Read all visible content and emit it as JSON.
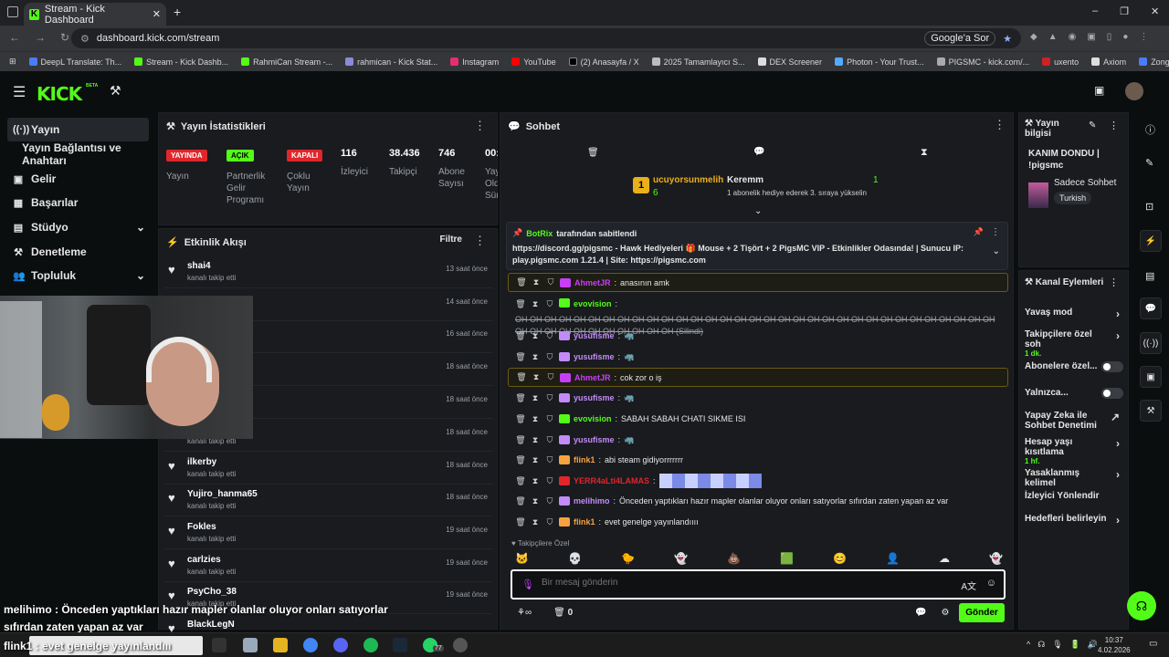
{
  "browser": {
    "tab_title": "Stream - Kick Dashboard",
    "url": "dashboard.kick.com/stream",
    "google_btn": "Google'a Sor",
    "bookmarks": [
      "DeepL Translate: Th...",
      "Stream - Kick Dashb...",
      "RahmiCan Stream -...",
      "rahmican - Kick Stat...",
      "Instagram",
      "YouTube",
      "(2) Anasayfa / X",
      "2025 Tamamlayıcı S...",
      "DEX Screener",
      "Photon - Your Trust...",
      "PIGSMC - kick.com/...",
      "uxento",
      "Axiom",
      "Zonguldak İngilizce..."
    ]
  },
  "header": {
    "logo": "KICK",
    "beta": "BETA"
  },
  "sidebar": {
    "items": [
      {
        "label": "Yayın",
        "icon": "((·))"
      },
      {
        "label": "Yayın Bağlantısı ve Anahtarı",
        "icon": ""
      },
      {
        "label": "Gelir",
        "icon": "▣"
      },
      {
        "label": "Başarılar",
        "icon": "▦"
      },
      {
        "label": "Stüdyo",
        "icon": "▤"
      },
      {
        "label": "Denetleme",
        "icon": "⚒"
      },
      {
        "label": "Topluluk",
        "icon": "👥"
      }
    ]
  },
  "stats": {
    "title": "Yayın İstatistikleri",
    "badges": [
      {
        "badge": "YAYINDA",
        "label": "Yayın",
        "color": "#e0262b"
      },
      {
        "badge": "AÇIK",
        "label": "Partnerlik Gelir Programı",
        "color": "#53fc18"
      },
      {
        "badge": "KAPALI",
        "label": "Çoklu Yayın",
        "color": "#e0262b"
      }
    ],
    "numbers": [
      {
        "value": "116",
        "label": "İzleyici"
      },
      {
        "value": "38.436",
        "label": "Takipçi"
      },
      {
        "value": "746",
        "label": "Abone Sayısı"
      },
      {
        "value": "00:",
        "label": "Yay Old Sür"
      }
    ]
  },
  "activity": {
    "title": "Etkinlik Akışı",
    "filter": "Filtre",
    "followed": "kanalı takip etti",
    "items": [
      {
        "name": "shai4",
        "time": "13 saat önce"
      },
      {
        "name": "",
        "time": "14 saat önce"
      },
      {
        "name": "",
        "time": "16 saat önce"
      },
      {
        "name": "_AP0",
        "time": "18 saat önce"
      },
      {
        "name": "",
        "time": "18 saat önce"
      },
      {
        "name": "",
        "time": "18 saat önce"
      },
      {
        "name": "ilkerby",
        "time": "18 saat önce"
      },
      {
        "name": "Yujiro_hanma65",
        "time": "18 saat önce"
      },
      {
        "name": "Fokles",
        "time": "19 saat önce"
      },
      {
        "name": "carlzies",
        "time": "19 saat önce"
      },
      {
        "name": "PsyCho_38",
        "time": "19 saat önce"
      },
      {
        "name": "BlackLegN",
        "time": ""
      }
    ]
  },
  "chat": {
    "title": "Sohbet",
    "leader1": {
      "name": "ucuyorsunmelih",
      "count": "6"
    },
    "leader2": {
      "name": "Keremm",
      "count": "1",
      "desc": "1 abonelik hediye ederek 3. sıraya yükselin"
    },
    "pinned": {
      "by": "BotRix",
      "by_suffix": "tarafından sabitlendi",
      "text": "https://discord.gg/pigsmc - Hawk Hediyeleri 🎁 Mouse + 2 Tişört + 2 PigsMC VIP - Etkinlikler Odasında! | Sunucu IP: play.pigsmc.com 1.21.4 | Site: https://pigsmc.com"
    },
    "messages": [
      {
        "user": "AhmetJR",
        "color": "#c63ff7",
        "text": "anasının amk",
        "hl": true
      },
      {
        "user": "evovision",
        "color": "#53fc18",
        "text": "OH OH OH OH OH OH OH OH OH OH OH OH OH OH OH OH OH OH OH OH OH OH OH OH OH OH OH OH OH OH OH OH OH OH OH OH OH OH OH OH OH OH OH OH (Silindi)",
        "hl": false
      },
      {
        "user": "yusufisme",
        "color": "#c38bf9",
        "text": "🦏",
        "hl": false
      },
      {
        "user": "yusufisme",
        "color": "#c38bf9",
        "text": "🦏",
        "hl": false
      },
      {
        "user": "AhmetJR",
        "color": "#c63ff7",
        "text": "cok zor o iş",
        "hl": true
      },
      {
        "user": "yusufisme",
        "color": "#c38bf9",
        "text": "🦏",
        "hl": false
      },
      {
        "user": "evovision",
        "color": "#53fc18",
        "text": "SABAH SABAH CHATI SIKME ISI",
        "hl": false
      },
      {
        "user": "yusufisme",
        "color": "#c38bf9",
        "text": "🦏",
        "hl": false
      },
      {
        "user": "flink1",
        "color": "#f7a23f",
        "text": "abi steam gidiyorrrrrrr",
        "hl": false
      },
      {
        "user": "YERR4aLti4LAMAS",
        "color": "#e0262b",
        "text": "",
        "hl": false
      },
      {
        "user": "melihimo",
        "color": "#c38bf9",
        "text": "Önceden yaptıkları hazır mapler olanlar oluyor onları satıyorlar sıfırdan zaten yapan az var",
        "hl": false
      },
      {
        "user": "flink1",
        "color": "#f7a23f",
        "text": "evet genelge yayınlandıııı",
        "hl": false
      }
    ],
    "followers_only": "Takipçilere Özel",
    "placeholder": "Bir mesaj gönderin",
    "send": "Gönder",
    "count": "0"
  },
  "stream_info": {
    "title": "Yayın bilgisi",
    "stream_title": "KANIM DONDU | !pigsmc",
    "category": "Sadece Sohbet",
    "tag": "Turkish"
  },
  "channel_actions": {
    "title": "Kanal Eylemleri",
    "items": [
      {
        "label": "Yavaş mod",
        "sub": "",
        "type": "arrow"
      },
      {
        "label": "Takipçilere özel soh",
        "sub": "1 dk.",
        "type": "arrow"
      },
      {
        "label": "Abonelere özel...",
        "sub": "",
        "type": "toggle"
      },
      {
        "label": "Yalnızca...",
        "sub": "",
        "type": "toggle"
      },
      {
        "label": "Yapay Zeka ile Sohbet Denetimi",
        "sub": "",
        "type": "ext"
      },
      {
        "label": "Hesap yaşı kısıtlama",
        "sub": "1 hf.",
        "type": "arrow"
      },
      {
        "label": "Yasaklanmış kelimel",
        "sub": "",
        "type": "arrow"
      },
      {
        "label": "İzleyici Yönlendir",
        "sub": "",
        "type": "none"
      },
      {
        "label": "Hedefleri belirleyin",
        "sub": "",
        "type": "arrow"
      }
    ]
  },
  "overlay": {
    "caption1": "melihimo : Önceden yaptıkları hazır mapler olanlar oluyor onları satıyorlar",
    "caption2": "sıfırdan zaten yapan az var",
    "caption3": "flink1 : evet genelge yayınlandııı"
  },
  "taskbar": {
    "time": "10:37",
    "date": "4.02.2026",
    "badge": "77"
  }
}
